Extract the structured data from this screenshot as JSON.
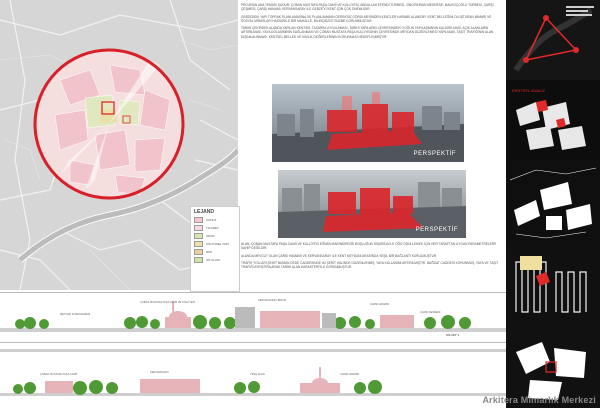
{
  "legend": {
    "title": "LEJAND",
    "items": [
      {
        "label": "KONUT",
        "color": "#f3c7cf"
      },
      {
        "label": "TİCARET",
        "color": "#f7dbe0"
      },
      {
        "label": "SPOR",
        "color": "#d7e6b5"
      },
      {
        "label": "KÜLTÜREL YAPI",
        "color": "#efe0a8"
      },
      {
        "label": "DİNİ",
        "color": "#e6d3a0"
      },
      {
        "label": "SİT ALANI",
        "color": "#cde4a7"
      }
    ]
  },
  "description": {
    "para1": "PROJENİN ANA TEMASI ŞUDUR: ÇOBAN MUSTAFA PAŞA CAMİİ VE KÜLLİYESİ, ABDULLAH EFENDİ TÜRBESİ, ZİNCİRKIRAN MEDRESE, MALKOÇOĞLU TÜRBESİ, ÇARŞI ÇEŞMESİ, ÇARŞI HAMAMI, KERVANSARAY İLE GEBZE'Yİ KENT İÇİN ÇOK ÖNEMLİDİR.",
    "para2": "GEBZEDEKİ YAPI TOPRAK PLANLAMASINA VE PLANLAMANIN GEREKSİZ GÖRÜLMESİNDEN KENTLER HARABE ALANIDIR. KENT BELLEĞİNİ OLUŞTURAN MİMARİ VE SOSYAL MİRASLARI HASSASİLE BİR MAHALLE, BİLİNÇSİZCE SÜZME KORUNMUŞTUR.",
    "para3": "TARİHİ ÇEKİRDEK ALANDA YAPILAN KENTSEL TASARIM UYGULAMASI, TARİHİ YAPILARIN ÇEVRESİNDEKİ YOĞUN YAPILAŞMANIN KALDIRILMASI, AÇIK ALANLARIN ARTIRILMASI, YAYA DOLAŞIMININ SAĞLANMASI VE ÇOBAN MUSTAFA PAŞA KÜLLİYESİNİN ÇEVRESİNDE MEYDAN DÜZENLEMESİ YAPILMASI, TAŞIT TRAFİĞİNİN ALAN DIŞINA ALINMASI, KENTSEL BELLEK VE KİMLİK DEĞERLERİNİN KORUNMASI HEDEFLENMİŞTİR."
  },
  "description2": {
    "para1": "ALAN, ÇOBAN MUSTAFA PAŞA CAMİİ VE KÜLLİYESİ EĞMEN BARINDIRDIĞI BOŞLUĞUN DIŞARIDA İLK ÖĞÜ ÖDÜLLEMEK İÇİN HER TARAFTAN UYGUN PARAMETRELERE SAHİP DEĞİLDİR.",
    "para2": "ALANDA MEVCUT OLAN ÇARŞI HAMAMI VE KERVANSARAY İLE KENT MEYDANI ARASINDA YEŞİL BİR BAĞLANTI KURULMUŞTUR.",
    "para3": "TRAFİK YOLLARI ŞEHİT NUMAN DEDE CADDESİNDE İKİ ŞERİT HALİNDE DÜZENLENMİŞ, YAYA KULLANIMI ARTIRILMIŞTIR. BAĞDAT CADDESİ KORUNMUŞ, YAYA VE TAŞIT TRAFİĞİ AYRIŞTIRILARAK TARİHİ ALAN KARAKTERİYLE KORUNMUŞTUR."
  },
  "views": {
    "view1_label": "PERSPEKTİF",
    "view2_label": "PERSPEKTİF"
  },
  "section": {
    "title1": "SİLÜET 1",
    "labels_top": [
      "ÇOBAN MUSTAFA PAŞA CAMİİ VE KÜLLİYESİ",
      "KERVANSARAY BİNASI",
      "MEYDAN DÜZENLEMESİ",
      "ÇARŞI HAMAMI",
      "ÇARŞI ÇEŞMESİ"
    ],
    "labels_bottom": [
      "ÇOBAN MUSTAFA PAŞA CAMİİ",
      "KERVANSARAY",
      "YEŞİL ALAN",
      "ÇARŞI HAMAMI"
    ]
  },
  "right_panel": {
    "title": "KENTSEL ANALİZ"
  },
  "watermark": "Arkitera Mimarlık Merkezi",
  "colors": {
    "circle": "#d8202a",
    "accent_red": "#e02a2a",
    "tree_green": "#3f8a2e"
  }
}
